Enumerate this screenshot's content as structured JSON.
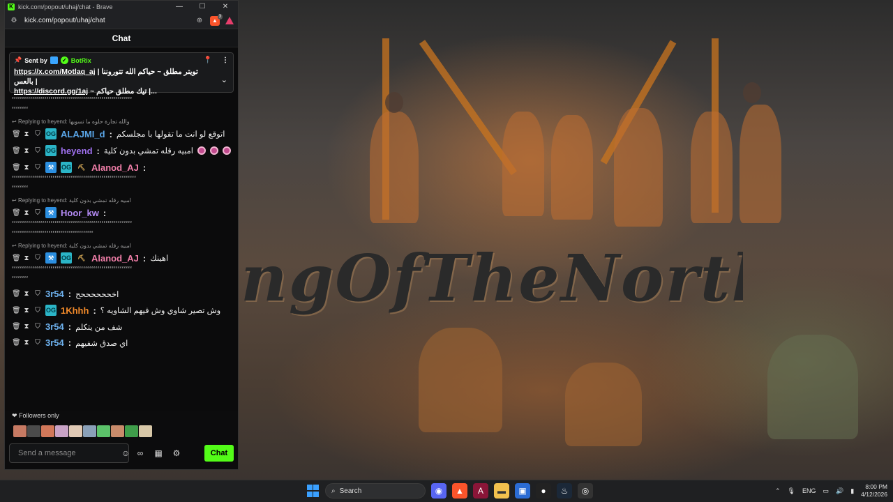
{
  "browser": {
    "window_title": "kick.com/popout/uhaj/chat - Brave",
    "url": "kick.com/popout/uhaj/chat",
    "shield_badge": "3",
    "window_controls": [
      "—",
      "☐",
      "✕"
    ]
  },
  "chat": {
    "header": "Chat",
    "pinned": {
      "sent_by_label": "Sent by",
      "bot_name": "BotRix",
      "line1_link": "https://x.com/Motlaq_aj",
      "line1_text": "| تويتر مطلق ~ حياكم الله تتوروننا بالعس |",
      "line2_link": "https://discord.gg/1aj",
      "line2_text": "~ تيك مطلق حياكم |...",
      "icons": [
        "pin-icon",
        "more-icon",
        "chevron-down-icon"
      ]
    },
    "top_cut_text": "ٰ ٰ ٰ ٰ ٰ ٰ ٰ ٰ",
    "messages": [
      {
        "kind": "emote",
        "text": "ٴٴٴٴٴٴٴٴٴٴٴٴٴٴٴٴٴٴٴٴٴٴٴٴٴٴٴٴٴٴٴٴٴٴٴٴٴٴٴٴٴٴٴٴٴٴٴٴٴٴٴٴٴٴٴٴٴٴٴ"
      },
      {
        "kind": "emote",
        "text": "ٴٴٴٴٴٴٴٴ"
      },
      {
        "kind": "reply",
        "text": "Replying to heyend: والله تجارة حلوه ما تسويها"
      },
      {
        "kind": "chat",
        "user": "ALAJMI_d",
        "color": "#5aa6e8",
        "badges": [
          "og"
        ],
        "text": "اتوقع لو انت ما تقولها با مجلسكم"
      },
      {
        "kind": "chat",
        "user": "heyend",
        "color": "#a071f0",
        "badges": [
          "og"
        ],
        "text": "امبيه رقله تمشي بدون كلية"
      },
      {
        "kind": "chat",
        "user": "Alanod_AJ",
        "color": "#f07ea8",
        "badges": [
          "blue",
          "og",
          "pick"
        ],
        "text": ""
      },
      {
        "kind": "emote",
        "text": "ٴٴٴٴٴٴٴٴٴٴٴٴٴٴٴٴٴٴٴٴٴٴٴٴٴٴٴٴٴٴٴٴٴٴٴٴٴٴٴٴٴٴٴٴٴٴٴٴٴٴٴٴٴٴٴٴٴٴٴٴٴ"
      },
      {
        "kind": "emote",
        "text": "ٴٴٴٴٴٴٴٴ"
      },
      {
        "kind": "reply",
        "text": "Replying to heyend: امبيه رقله تمشي بدون كلية"
      },
      {
        "kind": "chat",
        "user": "Hoor_kw",
        "color": "#b48bf5",
        "badges": [
          "blue"
        ],
        "text": ""
      },
      {
        "kind": "emote",
        "text": "ٴٴٴٴٴٴٴٴٴٴٴٴٴٴٴٴٴٴٴٴٴٴٴٴٴٴٴٴٴٴٴٴٴٴٴٴٴٴٴٴٴٴٴٴٴٴٴٴٴٴٴٴٴٴٴٴٴٴٴ"
      },
      {
        "kind": "emote",
        "text": "ٴٴٴٴٴٴٴٴٴٴٴٴٴٴٴٴٴٴٴٴٴٴٴٴٴٴٴٴٴٴٴٴٴٴٴٴٴٴٴٴ"
      },
      {
        "kind": "reply",
        "text": "Replying to heyend: امبيه رقله تمشي بدون كلية"
      },
      {
        "kind": "chat",
        "user": "Alanod_AJ",
        "color": "#f07ea8",
        "badges": [
          "blue",
          "og",
          "pick"
        ],
        "text": "اهينك"
      },
      {
        "kind": "emote",
        "text": "ٴٴٴٴٴٴٴٴٴٴٴٴٴٴٴٴٴٴٴٴٴٴٴٴٴٴٴٴٴٴٴٴٴٴٴٴٴٴٴٴٴٴٴٴٴٴٴٴٴٴٴٴٴٴٴٴٴٴٴ"
      },
      {
        "kind": "emote",
        "text": "ٴٴٴٴٴٴٴٴ"
      },
      {
        "kind": "chat",
        "user": "3r54",
        "color": "#6fb3f0",
        "badges": [],
        "text": "اخححححححح"
      },
      {
        "kind": "chat",
        "user": "1Khhh",
        "color": "#f28a2a",
        "badges": [
          "og"
        ],
        "text": "وش تصير شاوي وش فيهم الشاويه ؟"
      },
      {
        "kind": "chat",
        "user": "3r54",
        "color": "#6fb3f0",
        "badges": [],
        "text": "شف من يتكلم"
      },
      {
        "kind": "chat",
        "user": "3r54",
        "color": "#6fb3f0",
        "badges": [],
        "text": "اي صدق شفيهم"
      }
    ],
    "followers_only": "Followers only",
    "composer": {
      "placeholder": "Send a message",
      "send_label": "Chat"
    },
    "viewer_avatar_colors": [
      "#c77a63",
      "#4b4b4b",
      "#d2785a",
      "#c9a3c6",
      "#e0c9b5",
      "#8aa0b8",
      "#5cc26a",
      "#c98b6b",
      "#3f9d4a",
      "#d8c8a8"
    ]
  },
  "wallpaper": {
    "banner_text": "ngOfTheNorth"
  },
  "taskbar": {
    "search_label": "Search",
    "apps": [
      "discord-icon",
      "brave-icon",
      "affinity-icon",
      "file-explorer-icon",
      "ms-store-icon",
      "obs-icon",
      "steam-icon",
      "chrome-icon"
    ],
    "language": "ENG",
    "time": "8:00 PM",
    "date": "4/12/2026"
  }
}
